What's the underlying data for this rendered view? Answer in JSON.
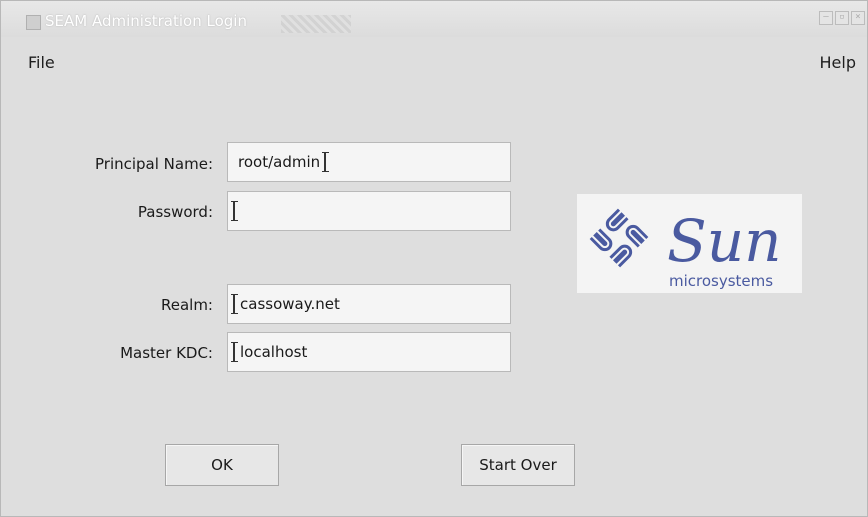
{
  "window": {
    "title": "SEAM Administration Login",
    "controls": [
      "minimize",
      "maximize",
      "close"
    ]
  },
  "menu": {
    "file": "File",
    "help": "Help"
  },
  "form": {
    "principal_label": "Principal Name:",
    "principal_value": "root/admin",
    "password_label": "Password:",
    "password_value": "",
    "realm_label": "Realm:",
    "realm_value": "cassoway.net",
    "kdc_label": "Master KDC:",
    "kdc_value": "localhost"
  },
  "logo": {
    "name": "Sun",
    "tagline": "microsystems",
    "color": "#4a5aa0"
  },
  "buttons": {
    "ok": "OK",
    "start_over": "Start Over"
  }
}
